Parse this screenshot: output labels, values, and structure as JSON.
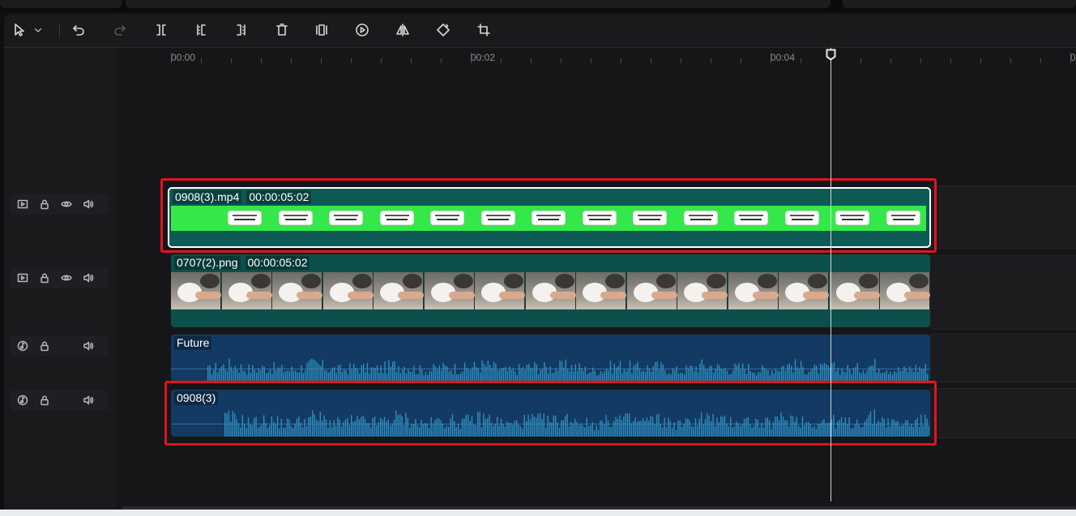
{
  "toolbar": {
    "tools": [
      {
        "name": "select-tool-icon",
        "enabled": true
      },
      {
        "name": "dropdown-chevron-icon",
        "enabled": true
      },
      {
        "name": "undo-icon",
        "enabled": true
      },
      {
        "name": "redo-icon",
        "enabled": false
      },
      {
        "name": "split-icon",
        "enabled": true
      },
      {
        "name": "trim-start-icon",
        "enabled": true
      },
      {
        "name": "trim-end-icon",
        "enabled": true
      },
      {
        "name": "delete-icon",
        "enabled": true
      },
      {
        "name": "freeze-frame-icon",
        "enabled": true
      },
      {
        "name": "reverse-icon",
        "enabled": true
      },
      {
        "name": "mirror-icon",
        "enabled": true
      },
      {
        "name": "rotate-icon",
        "enabled": true
      },
      {
        "name": "crop-icon",
        "enabled": true
      }
    ]
  },
  "ruler": {
    "marks": [
      "00:00",
      "00:02",
      "00:04"
    ]
  },
  "tracks": [
    {
      "kind": "video",
      "icons": [
        "video-track-icon",
        "lock-icon",
        "eye-icon",
        "volume-icon"
      ]
    },
    {
      "kind": "video",
      "icons": [
        "video-track-icon",
        "lock-icon",
        "eye-icon",
        "volume-icon"
      ]
    },
    {
      "kind": "audio",
      "icons": [
        "music-note-icon",
        "lock-icon",
        "",
        "volume-icon"
      ]
    },
    {
      "kind": "audio",
      "icons": [
        "music-note-icon",
        "lock-icon",
        "",
        "volume-icon"
      ]
    }
  ],
  "clips": {
    "video": {
      "name": "0908(3).mp4",
      "duration": "00:00:05:02"
    },
    "image": {
      "name": "0707(2).png",
      "duration": "00:00:05:02"
    },
    "music": {
      "name": "Future"
    },
    "voice": {
      "name": "0908(3)"
    }
  },
  "colors": {
    "highlight": "#e0141f",
    "video_clip": "#0e5a55",
    "green_screen": "#35e84a",
    "audio_clip": "#123a62",
    "waveform": "#2f8fc0"
  },
  "playhead": {
    "time_seconds": 4.4
  }
}
